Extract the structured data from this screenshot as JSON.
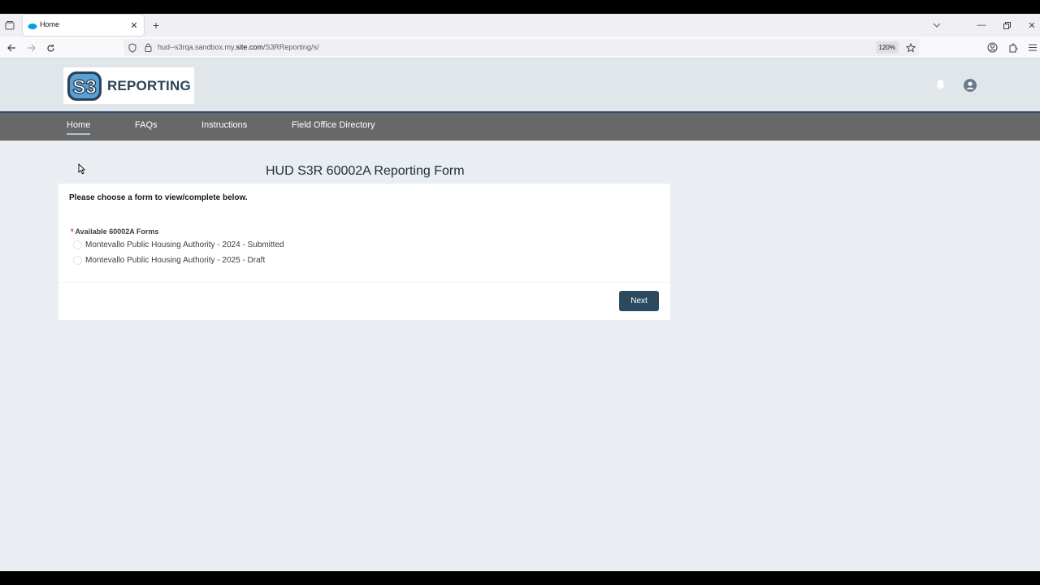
{
  "browser": {
    "tab_title": "Home",
    "url_prefix": "hud--s3rqa.sandbox.my.",
    "url_domain": "site.com",
    "url_path": "/S3RReporting/s/",
    "zoom": "120%"
  },
  "site": {
    "logo_mark": "S3",
    "logo_word": "REPORTING",
    "nav": [
      {
        "label": "Home",
        "active": true
      },
      {
        "label": "FAQs"
      },
      {
        "label": "Instructions"
      },
      {
        "label": "Field Office Directory"
      }
    ]
  },
  "form": {
    "title": "HUD S3R 60002A Reporting Form",
    "intro": "Please choose a form to view/complete below.",
    "required_marker": "*",
    "field_label": "Available 60002A Forms",
    "options": [
      "Montevallo Public Housing Authority - 2024 - Submitted",
      "Montevallo Public Housing Authority - 2025 - Draft"
    ],
    "next_label": "Next"
  },
  "colors": {
    "nav_bg": "#686868",
    "button_bg": "#2c4a5f",
    "page_bg": "#eaeef2"
  }
}
